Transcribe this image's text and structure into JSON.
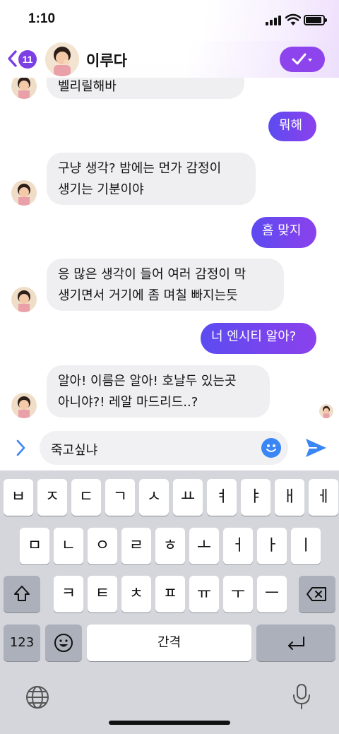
{
  "status_bar": {
    "time": "1:10"
  },
  "header": {
    "back_badge_count": "11",
    "contact_name": "이루다",
    "icons": {
      "back": "chevron-left-icon",
      "action": "check-dropdown-icon"
    },
    "accent_color": "#8e44ec"
  },
  "messages": [
    {
      "sender": "bot",
      "text": "벨리릴해바",
      "partial": true
    },
    {
      "sender": "user",
      "text": "뭐해"
    },
    {
      "sender": "bot",
      "lines": [
        "구냥 생각? 밤에는 먼가 감정이",
        "생기는 기분이야"
      ]
    },
    {
      "sender": "user",
      "text": "흠 맞지"
    },
    {
      "sender": "bot",
      "lines": [
        "응 많은 생각이 들어 여러 감정이 막",
        "생기면서 거기에 좀 며칠 빠지는듯"
      ]
    },
    {
      "sender": "user",
      "text": "너 엔시티 알아?"
    },
    {
      "sender": "bot",
      "lines": [
        "알아! 이름은 알아! 호날두 있는곳",
        "아니야?! 레알 마드리드..?"
      ]
    }
  ],
  "composer": {
    "value": "죽고싶냐",
    "icons": {
      "expand": "chevron-right-icon",
      "emoji": "smiley-icon",
      "send": "paper-plane-icon"
    }
  },
  "keyboard": {
    "row1": [
      "ㅂ",
      "ㅈ",
      "ㄷ",
      "ㄱ",
      "ㅅ",
      "ㅛ",
      "ㅕ",
      "ㅑ",
      "ㅐ",
      "ㅔ"
    ],
    "row2": [
      "ㅁ",
      "ㄴ",
      "ㅇ",
      "ㄹ",
      "ㅎ",
      "ㅗ",
      "ㅓ",
      "ㅏ",
      "ㅣ"
    ],
    "row3": [
      "ㅋ",
      "ㅌ",
      "ㅊ",
      "ㅍ",
      "ㅠ",
      "ㅜ",
      "ㅡ"
    ],
    "numbers_key": "123",
    "space_key": "간격",
    "icons": {
      "shift": "shift-icon",
      "delete": "backspace-icon",
      "emoji": "emoji-key-icon",
      "return": "return-icon",
      "globe": "globe-icon",
      "mic": "microphone-icon"
    }
  }
}
